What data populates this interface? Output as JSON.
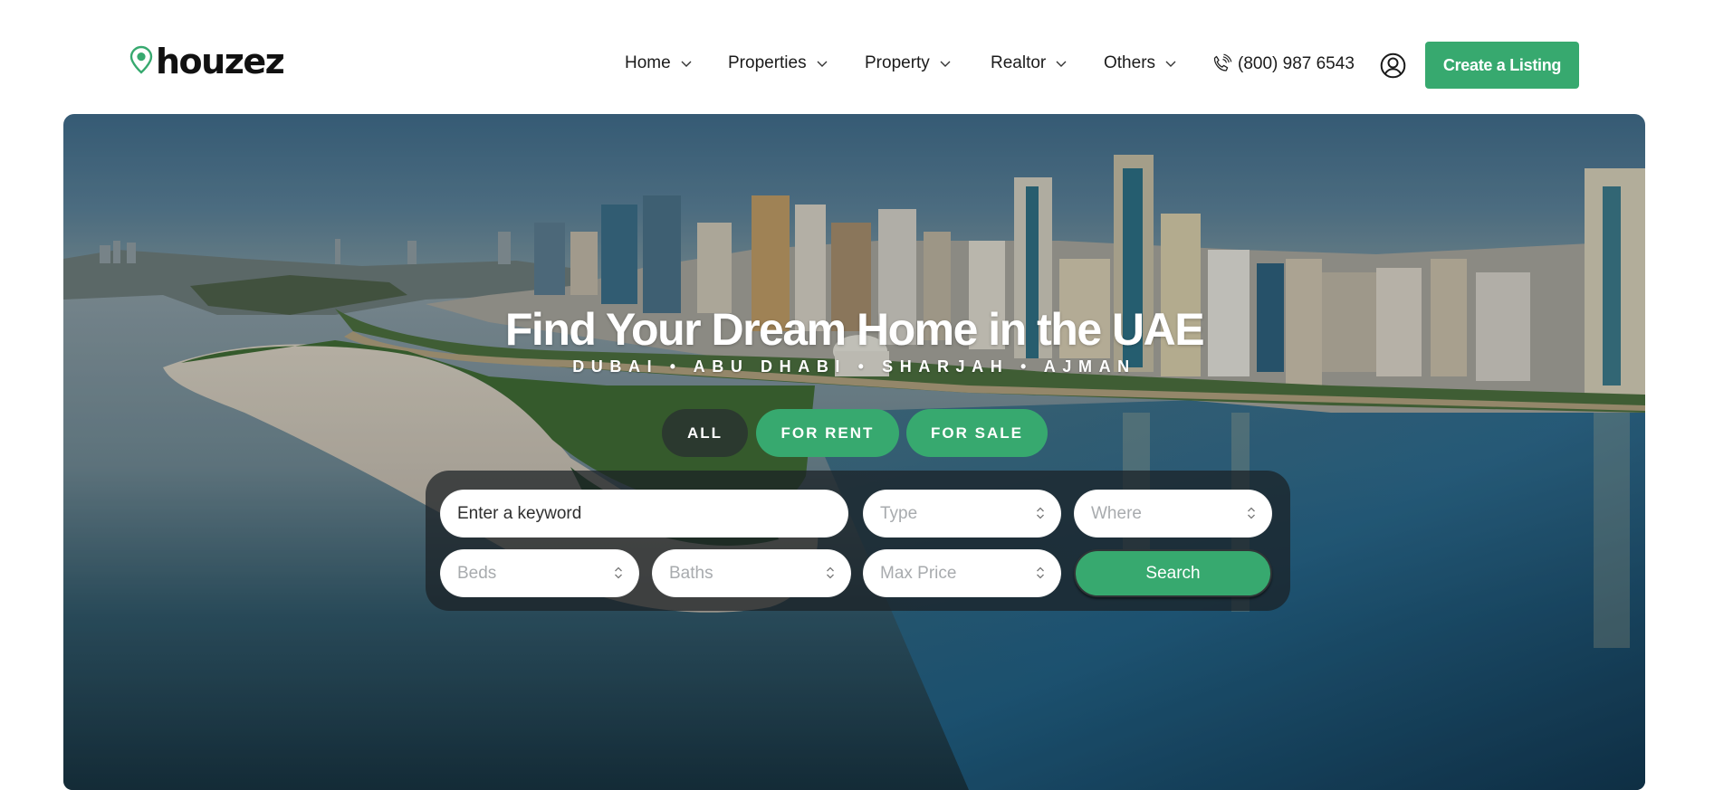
{
  "brand": {
    "name": "houzez",
    "logo_icon": "map-pin-icon",
    "accent_color": "#37a96f"
  },
  "nav": {
    "items": [
      {
        "label": "Home",
        "icon": "chevron-down-icon"
      },
      {
        "label": "Properties",
        "icon": "chevron-down-icon"
      },
      {
        "label": "Property",
        "icon": "chevron-down-icon"
      },
      {
        "label": "Realtor",
        "icon": "chevron-down-icon"
      },
      {
        "label": "Others",
        "icon": "chevron-down-icon"
      }
    ],
    "phone": {
      "icon": "phone-icon",
      "number": "(800) 987 6543"
    },
    "user_icon": "user-circle-icon",
    "cta_label": "Create a Listing"
  },
  "hero": {
    "title": "Find Your Dream Home in the UAE",
    "subtitle": "DUBAI • ABU DHABI • SHARJAH • AJMAN",
    "background": "aerial-photo-city-skyline-lagoon-island",
    "tabs": [
      {
        "label": "ALL",
        "active": false
      },
      {
        "label": "FOR RENT",
        "active": true
      },
      {
        "label": "FOR SALE",
        "active": true
      }
    ],
    "search": {
      "keyword_placeholder": "Enter a keyword",
      "keyword_value": "",
      "selects": {
        "type": "Type",
        "where": "Where",
        "beds": "Beds",
        "baths": "Baths",
        "max_price": "Max Price"
      },
      "select_icon": "updown-chevron-icon",
      "button_label": "Search"
    }
  }
}
